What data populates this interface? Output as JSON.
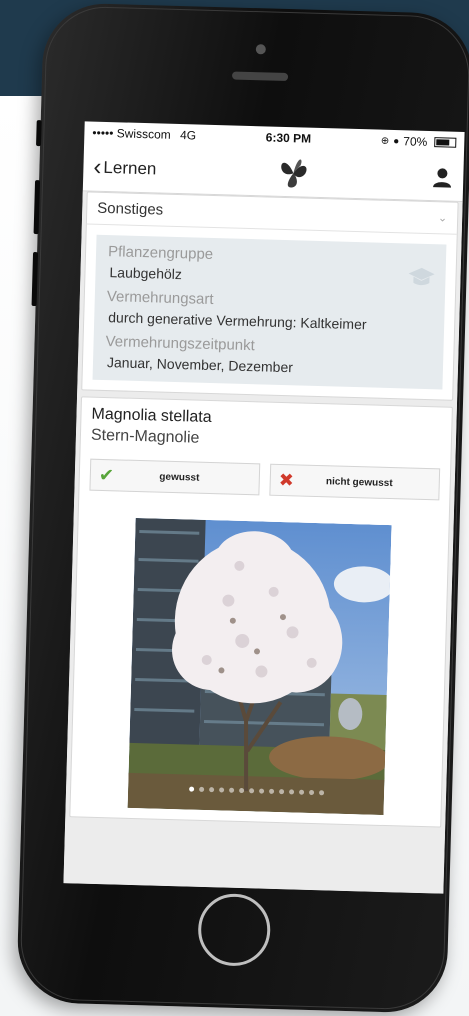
{
  "status": {
    "carrier": "••••• Swisscom",
    "network": "4G",
    "time": "6:30 PM",
    "battery": "70%",
    "battery_level": 0.7,
    "icons": [
      "lock-rotation-icon",
      "alarm-icon"
    ]
  },
  "nav": {
    "back_label": "Lernen",
    "back_icon": "chevron-left-icon",
    "logo_icon": "plant-logo-icon",
    "profile_icon": "user-icon"
  },
  "filter": {
    "selected": "Sonstiges"
  },
  "info": {
    "fields": [
      {
        "label": "Pflanzengruppe",
        "value": "Laubgehölz"
      },
      {
        "label": "Vermehrungsart",
        "value": "durch generative Vermehrung: Kaltkeimer"
      },
      {
        "label": "Vermehrungszeitpunkt",
        "value": "Januar, November, Dezember"
      }
    ],
    "badge_icon": "graduation-cap-icon"
  },
  "plant": {
    "latin_name": "Magnolia stellata",
    "common_name": "Stern-Magnolie",
    "known_label": "gewusst",
    "not_known_label": "nicht gewusst"
  },
  "gallery": {
    "dot_count": 14,
    "active_index": 0
  },
  "colors": {
    "banner": "#1f3a4d",
    "check": "#58a53a",
    "cross": "#d0392b",
    "panel": "#e6ebee"
  }
}
